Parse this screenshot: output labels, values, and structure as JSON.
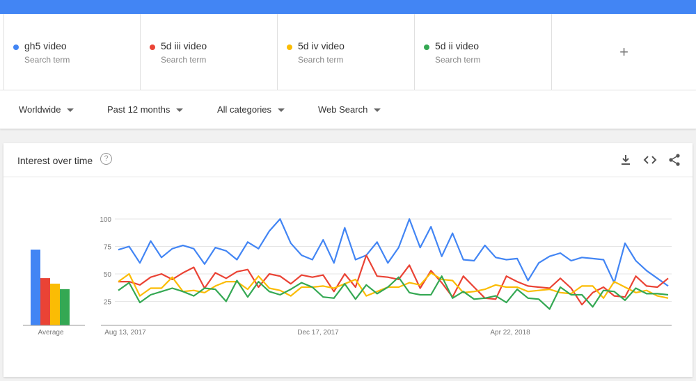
{
  "terms": [
    {
      "name": "gh5 video",
      "sub": "Search term",
      "color": "#4285f4"
    },
    {
      "name": "5d iii video",
      "sub": "Search term",
      "color": "#ea4335"
    },
    {
      "name": "5d iv video",
      "sub": "Search term",
      "color": "#fbbc04"
    },
    {
      "name": "5d ii video",
      "sub": "Search term",
      "color": "#34a853"
    }
  ],
  "add_term_label": "+",
  "filters": {
    "region": "Worldwide",
    "time": "Past 12 months",
    "category": "All categories",
    "search_type": "Web Search"
  },
  "card": {
    "title": "Interest over time",
    "help": "?",
    "actions": [
      "download-icon",
      "embed-icon",
      "share-icon"
    ]
  },
  "chart_data": {
    "type": "line",
    "y_ticks": [
      "25",
      "50",
      "75",
      "100"
    ],
    "ylim": [
      0,
      100
    ],
    "x_tick_labels": [
      "Aug 13, 2017",
      "Dec 17, 2017",
      "Apr 22, 2018"
    ],
    "average_label": "Average",
    "averages": [
      69,
      43,
      38,
      33
    ],
    "series": [
      {
        "name": "gh5 video",
        "color": "#4285f4",
        "values": [
          72,
          75,
          60,
          80,
          65,
          73,
          76,
          73,
          59,
          74,
          71,
          63,
          79,
          73,
          89,
          100,
          78,
          67,
          63,
          81,
          60,
          92,
          63,
          67,
          79,
          60,
          74,
          100,
          74,
          93,
          66,
          87,
          63,
          62,
          76,
          65,
          63,
          64,
          44,
          60,
          66,
          69,
          62,
          65,
          64,
          63,
          42,
          78,
          62,
          53,
          46,
          39
        ]
      },
      {
        "name": "5d iii video",
        "color": "#ea4335",
        "values": [
          43,
          43,
          40,
          47,
          50,
          45,
          51,
          56,
          37,
          51,
          46,
          52,
          54,
          38,
          50,
          48,
          41,
          49,
          47,
          49,
          34,
          50,
          38,
          67,
          48,
          47,
          45,
          58,
          37,
          53,
          42,
          29,
          48,
          38,
          28,
          27,
          48,
          43,
          39,
          38,
          37,
          46,
          37,
          22,
          33,
          38,
          30,
          29,
          48,
          39,
          38,
          46
        ]
      },
      {
        "name": "5d iv video",
        "color": "#fbbc04",
        "values": [
          43,
          50,
          30,
          37,
          37,
          47,
          34,
          35,
          33,
          39,
          43,
          43,
          36,
          48,
          37,
          35,
          30,
          38,
          38,
          39,
          37,
          41,
          45,
          30,
          34,
          38,
          38,
          42,
          40,
          51,
          45,
          44,
          33,
          34,
          36,
          40,
          38,
          38,
          34,
          35,
          36,
          33,
          32,
          39,
          39,
          28,
          43,
          38,
          33,
          35,
          30,
          28
        ]
      },
      {
        "name": "5d ii video",
        "color": "#34a853",
        "values": [
          35,
          42,
          24,
          31,
          34,
          37,
          34,
          30,
          37,
          36,
          25,
          44,
          29,
          43,
          34,
          31,
          36,
          42,
          38,
          29,
          28,
          41,
          27,
          40,
          32,
          38,
          47,
          33,
          31,
          31,
          48,
          28,
          34,
          27,
          28,
          30,
          24,
          36,
          28,
          27,
          18,
          38,
          31,
          31,
          20,
          35,
          34,
          26,
          37,
          32,
          32,
          31
        ]
      }
    ]
  }
}
